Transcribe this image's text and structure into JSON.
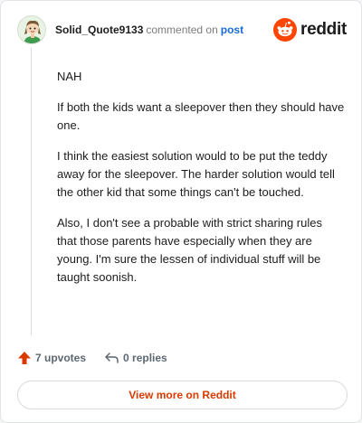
{
  "comment": {
    "username": "Solid_Quote9133",
    "action_text": "commented on",
    "post_link": "post",
    "paragraphs": [
      "NAH",
      "If both the kids want a sleepover then they should have one.",
      "I think the easiest solution would to be put the teddy away for the sleepover. The harder solution would tell the other kid that some things can't be touched.",
      "Also, I don't see a probable with strict sharing rules that those parents have especially when they are young. I'm sure the lessen of individual stuff will be taught soonish."
    ]
  },
  "brand": {
    "name": "reddit",
    "icon": "reddit-logo-icon",
    "color": "#ff4500"
  },
  "actions": {
    "upvotes": "7 upvotes",
    "upvote_icon": "upvote-arrow-icon",
    "replies": "0 replies",
    "reply_icon": "reply-arrow-icon",
    "upvote_color": "#d93a00"
  },
  "cta": {
    "label": "View more on Reddit"
  }
}
